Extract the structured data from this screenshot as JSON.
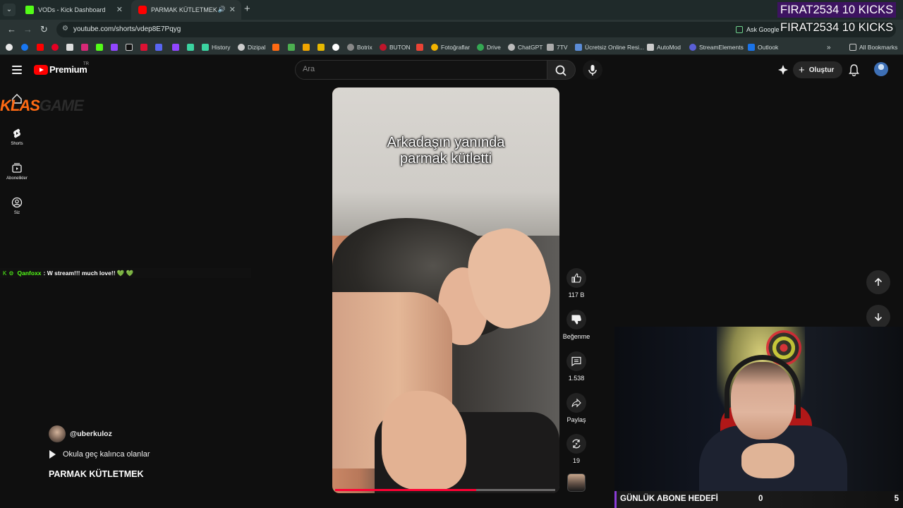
{
  "browser": {
    "tabs": [
      {
        "title": "VODs - Kick Dashboard",
        "favicon_color": "#53fc18"
      },
      {
        "title": "PARMAK KÜTLETMEK - YouTube",
        "favicon_color": "#ff0000"
      }
    ],
    "url": "youtube.com/shorts/vdep8E7Pqyg",
    "ask_google_label": "Ask Google",
    "bookmarks": [
      {
        "label": "History",
        "color": "#3bd3a0"
      },
      {
        "label": "Dizipal",
        "color": "#cccccc"
      },
      {
        "label": "Botrix",
        "color": "#888888"
      },
      {
        "label": "BUTON",
        "color": "#c0152b"
      },
      {
        "label": "Fotoğraflar",
        "color": "#f4b400"
      },
      {
        "label": "Drive",
        "color": "#34a853"
      },
      {
        "label": "ChatGPT",
        "color": "#bbbbbb"
      },
      {
        "label": "7TV",
        "color": "#aaaaaa"
      },
      {
        "label": "Ücretsiz Online Resi...",
        "color": "#5b8cd6"
      },
      {
        "label": "AutoMod",
        "color": "#cccccc"
      },
      {
        "label": "StreamElements",
        "color": "#5a5fd6"
      },
      {
        "label": "Outlook",
        "color": "#1a73e8"
      }
    ],
    "all_bookmarks_label": "All Bookmarks"
  },
  "youtube": {
    "brand": "Premium",
    "region": "TR",
    "search_placeholder": "Ara",
    "create_label": "Oluştur",
    "guide": [
      {
        "label": "Shorts"
      },
      {
        "label": "Abonelikler"
      },
      {
        "label": "Siz"
      }
    ]
  },
  "short": {
    "caption_line1": "Arkadaşın yanında",
    "caption_line2": "parmak kütletti",
    "progress_fraction": 0.64,
    "channel": "@uberkuloz",
    "description": "Okula geç kalınca olanlar",
    "title": "PARMAK KÜTLETMEK",
    "actions": {
      "like_count": "117 B",
      "dislike_label": "Beğenme",
      "comment_count": "1.538",
      "share_label": "Paylaş",
      "remix_count": "19"
    }
  },
  "stream_overlay": {
    "kick_logo_part1": "KLAS",
    "kick_logo_part2": "GAME",
    "chat": {
      "user": "Qanfoxx",
      "message": "W stream!!! much love!! 💚 💚"
    },
    "kicks_line1": "FIRAT2534  10 KICKS",
    "kicks_line2": "FIRAT2534  10 KICKS",
    "goal_label": "GÜNLÜK ABONE HEDEFİ",
    "goal_current": "0",
    "goal_target": "5"
  }
}
